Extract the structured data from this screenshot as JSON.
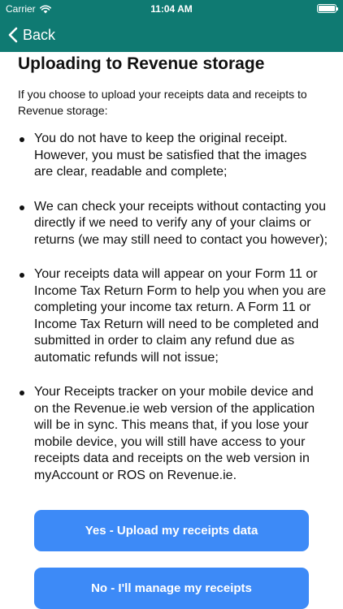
{
  "status_bar": {
    "carrier": "Carrier",
    "time": "11:04 AM"
  },
  "nav": {
    "back_label": "Back"
  },
  "page": {
    "title": "Uploading to Revenue storage",
    "intro": "If you choose to upload your receipts data and receipts to Revenue storage:",
    "bullets": [
      "You do not have to keep the original receipt. However, you must be satisfied that the images are clear, readable and complete;",
      "We can check your receipts without contacting you directly if we need to verify any of your claims or returns (we may still need to contact you however);",
      "Your receipts data will appear on your Form 11 or Income Tax Return Form to help you when you are completing your income tax return. A Form 11 or Income Tax Return will need to be completed and submitted in order to claim any refund due as automatic refunds will not issue;",
      "Your Receipts tracker on your mobile device and on the Revenue.ie web version of the application will be in sync. This means that, if you lose your mobile device, you will still have access to your receipts data and receipts on the web version in myAccount or ROS on Revenue.ie."
    ]
  },
  "buttons": {
    "yes_label": "Yes - Upload my receipts data",
    "no_label": "No - I'll manage my receipts"
  },
  "colors": {
    "header": "#0f7a72",
    "button": "#3d8af7"
  },
  "icons": {
    "back": "chevron-left-icon",
    "wifi": "wifi-icon",
    "battery": "battery-icon"
  }
}
